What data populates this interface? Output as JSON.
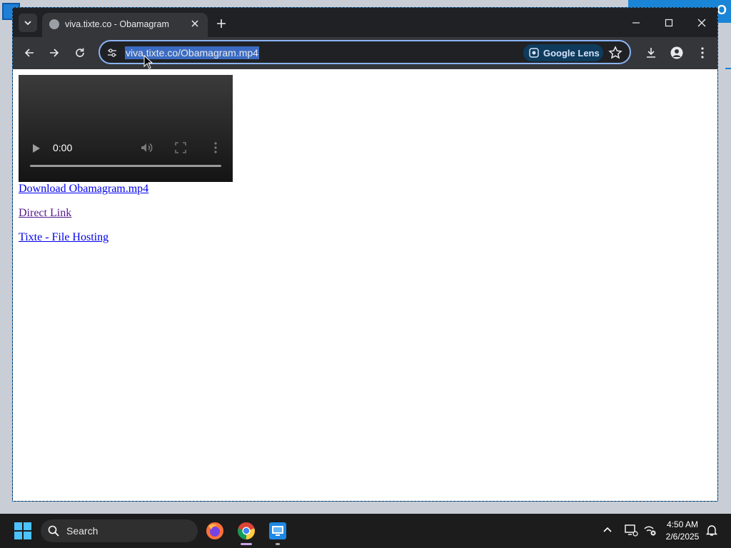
{
  "browser": {
    "tab": {
      "title": "viva.tixte.co - Obamagram"
    },
    "omnibox": {
      "url": "viva.tixte.co/Obamagram.mp4",
      "lens_label": "Google Lens"
    }
  },
  "page": {
    "video": {
      "time": "0:00"
    },
    "links": {
      "download": "Download Obamagram.mp4",
      "direct": "Direct Link",
      "hosting": "Tixte - File Hosting"
    }
  },
  "taskbar": {
    "search_label": "Search",
    "apps": [
      "firefox-icon",
      "chrome-icon",
      "remote-desktop-icon"
    ],
    "clock": {
      "time": "4:50 AM",
      "date": "2/6/2025"
    }
  },
  "desktop": {
    "right_bar_glyph": "O"
  },
  "colors": {
    "accent": "#8ab4f8",
    "link": "#0000ee",
    "visited_link": "#551a8b",
    "taskbar": "#1c1c1c"
  }
}
